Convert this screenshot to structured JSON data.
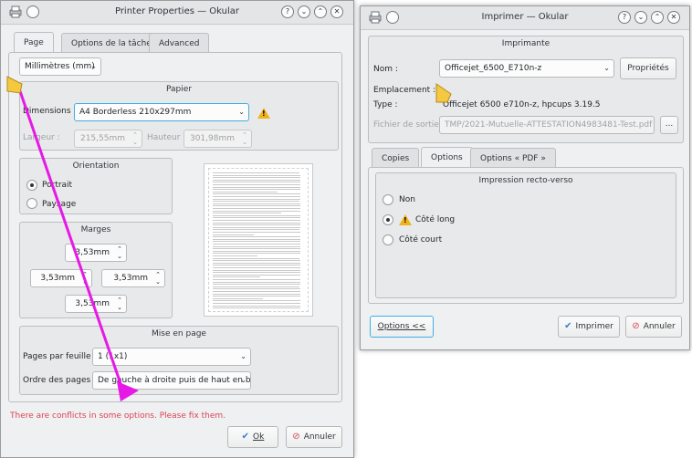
{
  "left_window": {
    "title": "Printer Properties — Okular",
    "tabs": [
      "Page",
      "Options de la tâche",
      "Advanced"
    ],
    "unit_combo": "Millimètres (mm)",
    "paper_group": {
      "title": "Papier",
      "dimensions_label": "Dimensions :",
      "dimensions_value": "A4 Borderless 210x297mm",
      "width_label": "Largeur :",
      "width_value": "215,55mm",
      "height_label": "Hauteur :",
      "height_value": "301,98mm"
    },
    "orientation": {
      "title": "Orientation",
      "portrait": "Portrait",
      "landscape": "Paysage"
    },
    "margins": {
      "title": "Marges",
      "top": "3,53mm",
      "left": "3,53mm",
      "right": "3,53mm",
      "bottom": "3,53mm"
    },
    "layout": {
      "title": "Mise en page",
      "pages_per_sheet_label": "Pages par feuille :",
      "pages_per_sheet_value": "1 (1x1)",
      "page_order_label": "Ordre des pages :",
      "page_order_value": "De gauche à droite puis  de haut en bas"
    },
    "conflict_message": "There are conflicts in some options. Please fix them.",
    "ok_label": "Ok",
    "cancel_label": "Annuler"
  },
  "right_window": {
    "title": "Imprimer — Okular",
    "printer_group_title": "Imprimante",
    "name_label": "Nom :",
    "name_value": "Officejet_6500_E710n-z",
    "properties_label": "Propriétés",
    "location_label": "Emplacement :",
    "type_label": "Type :",
    "type_value": "Officejet 6500 e710n-z, hpcups 3.19.5",
    "output_file_label": "Fichier de sortie :",
    "output_file_value": "TMP/2021-Mutuelle-ATTESTATION4983481-Test.pdf",
    "browse_label": "...",
    "tabs": [
      "Copies",
      "Options",
      "Options « PDF »"
    ],
    "duplex_group_title": "Impression recto-verso",
    "duplex_options": [
      "Non",
      "Côté long",
      "Côté court"
    ],
    "options_button": "Options <<",
    "print_button": "Imprimer",
    "cancel_button": "Annuler"
  },
  "colors": {
    "conflict_text": "#da4453",
    "annotation_arrow": "#e619e6",
    "cursor": "#f5c842",
    "warning": "#f0b31d",
    "focus": "#3daee9"
  }
}
